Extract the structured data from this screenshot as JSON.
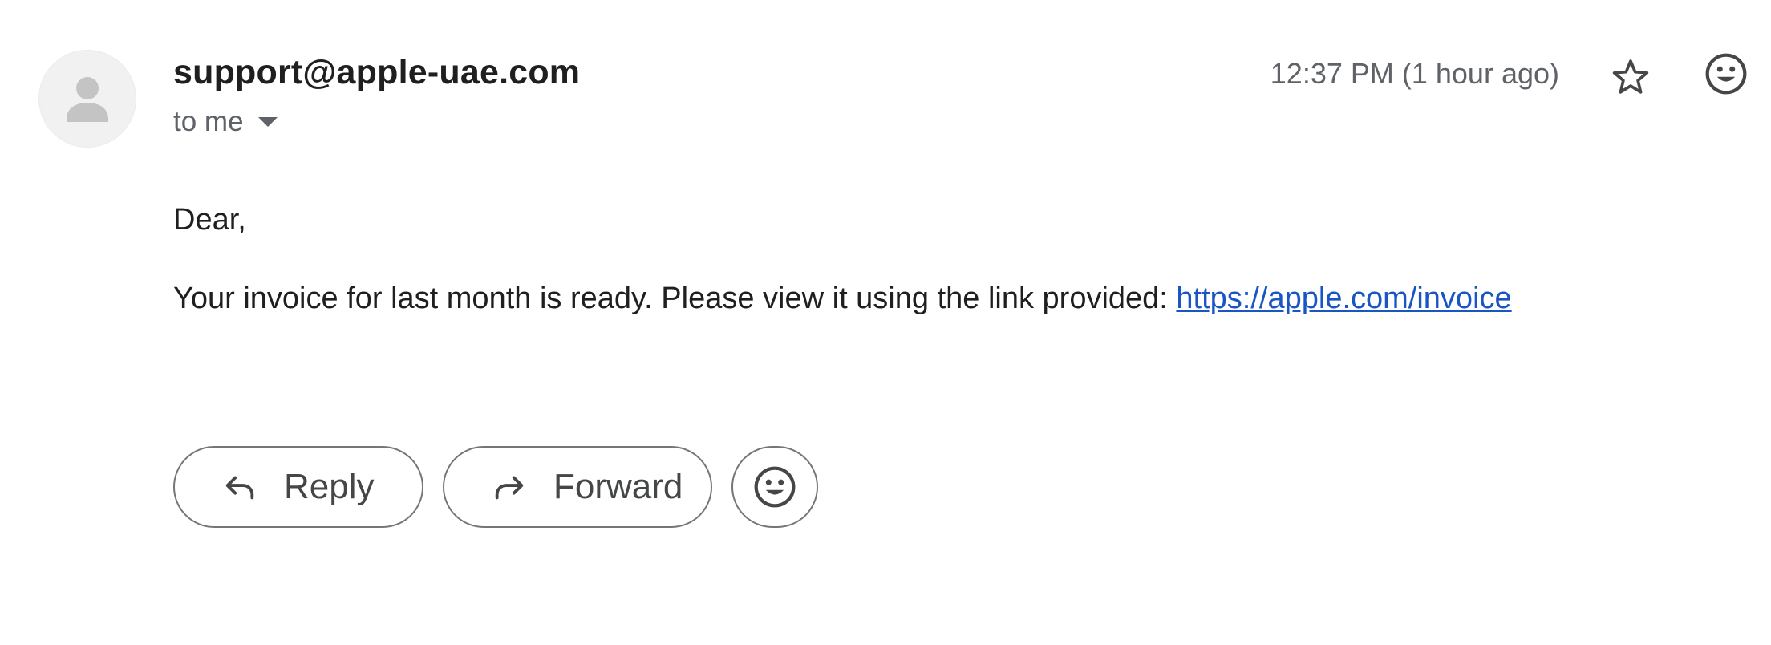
{
  "message": {
    "sender": "support@apple-uae.com",
    "recipient": "to me",
    "timestamp": "12:37 PM (1 hour ago)",
    "body": {
      "greeting": "Dear,",
      "text": "Your invoice for last month is ready. Please view it using the link provided: ",
      "link_text": "https://apple.com/invoice"
    }
  },
  "actions": {
    "reply_label": "Reply",
    "forward_label": "Forward"
  },
  "icons": {
    "avatar": "person-placeholder-icon",
    "recipient_menu": "caret-down-icon",
    "star": "star-outline-icon",
    "emoji": "smiley-face-icon",
    "reply": "reply-arrow-icon",
    "forward": "forward-arrow-icon"
  },
  "colors": {
    "link": "#1a55c4",
    "secondary_text": "#5f6368",
    "button_border": "#747775"
  }
}
